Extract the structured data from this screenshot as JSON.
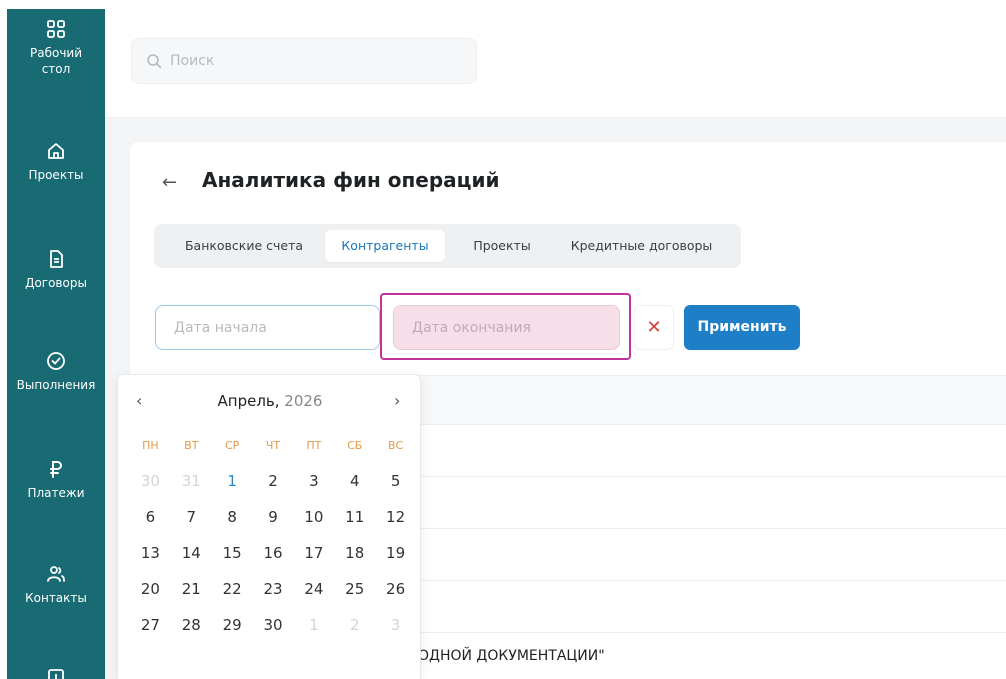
{
  "sidebar": {
    "items": [
      {
        "label": "Рабочий стол",
        "icon": "grid-icon"
      },
      {
        "label": "Проекты",
        "icon": "home-icon"
      },
      {
        "label": "Договоры",
        "icon": "document-icon"
      },
      {
        "label": "Выполнения",
        "icon": "check-circle-icon"
      },
      {
        "label": "Платежи",
        "icon": "ruble-icon"
      },
      {
        "label": "Контакты",
        "icon": "users-icon"
      }
    ]
  },
  "header": {
    "search_placeholder": "Поиск"
  },
  "page": {
    "title": "Аналитика фин операций",
    "tabs": [
      {
        "label": "Банковские счета",
        "active": false
      },
      {
        "label": "Контрагенты",
        "active": true
      },
      {
        "label": "Проекты",
        "active": false
      },
      {
        "label": "Кредитные договоры",
        "active": false
      }
    ],
    "filters": {
      "start_placeholder": "Дата начала",
      "end_placeholder": "Дата окончания",
      "clear_label": "✕",
      "apply_label": "Применить"
    },
    "table": {
      "partial_row_text": "ОДНОЙ ДОКУМЕНТАЦИИ\""
    }
  },
  "calendar": {
    "month": "Апрель,",
    "year": "2026",
    "weekdays": [
      "ПН",
      "ВТ",
      "СР",
      "ЧТ",
      "ПТ",
      "СБ",
      "ВС"
    ],
    "weeks": [
      [
        "30",
        "31",
        "1",
        "2",
        "3",
        "4",
        "5"
      ],
      [
        "6",
        "7",
        "8",
        "9",
        "10",
        "11",
        "12"
      ],
      [
        "13",
        "14",
        "15",
        "16",
        "17",
        "18",
        "19"
      ],
      [
        "20",
        "21",
        "22",
        "23",
        "24",
        "25",
        "26"
      ],
      [
        "27",
        "28",
        "29",
        "30",
        "1",
        "2",
        "3"
      ]
    ],
    "today": "1"
  },
  "colors": {
    "sidebar": "#186a73",
    "accent": "#1f7fc6",
    "highlight": "#c2349b",
    "weekday": "#e09a4a",
    "clear": "#d0423a"
  }
}
